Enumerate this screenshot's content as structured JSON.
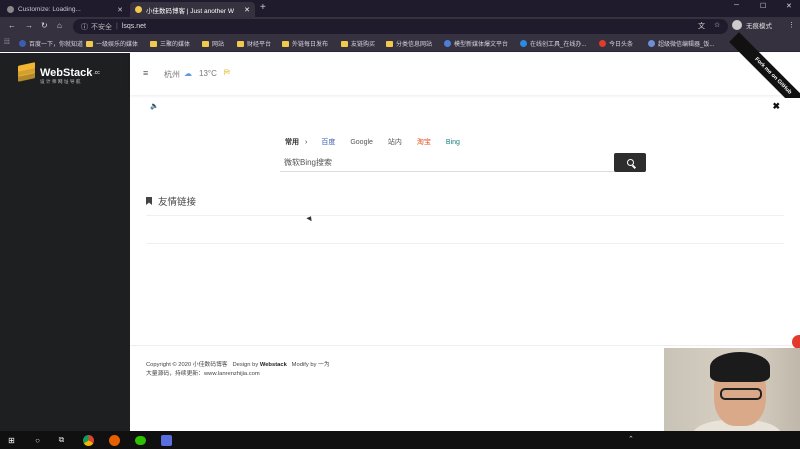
{
  "browser": {
    "tabs": [
      {
        "title": "Customize: Loading...",
        "active": false
      },
      {
        "title": "小佳数码博客 | Just another W",
        "active": true
      }
    ],
    "new_tab": "+",
    "window_controls": [
      "─",
      "☐",
      "✕"
    ],
    "address": {
      "security": "不安全",
      "separator": "|",
      "url": "lsqs.net"
    },
    "profile_label": "无痕模式",
    "bookmarks": [
      "百度一下，你就知道",
      "一级娱乐的媒体",
      "三聚的媒体",
      "网站",
      "财经平台",
      "外链每日发布",
      "友链购买",
      "分类信息网站",
      "模型新媒体爆文平台",
      "在线创工具_在线办...",
      "今日头条",
      "超级微信编辑器_饭..."
    ]
  },
  "sidebar": {
    "logo_name": "WebStack",
    "logo_suffix": ".cc",
    "logo_tagline": "设计师网址导航"
  },
  "header": {
    "city": "杭州",
    "temperature": "13°C",
    "ribbon": "Fork me on GitHub"
  },
  "search": {
    "group_label": "常用",
    "arrow": "›",
    "engines": [
      {
        "label": "百度",
        "color": "#3b5db0"
      },
      {
        "label": "Google",
        "color": "#555555"
      },
      {
        "label": "站内",
        "color": "#555555"
      },
      {
        "label": "淘宝",
        "color": "#e44d1f"
      },
      {
        "label": "Bing",
        "color": "#1a7d7d"
      }
    ],
    "placeholder": "微软Bing搜索"
  },
  "section": {
    "title": "友情链接"
  },
  "footer": {
    "copyright": "Copyright © 2020 小佳数码博客",
    "design_prefix": "Design by",
    "design_by": "Webstack",
    "modify": "Modify by 一为",
    "line2": "大量源码，持续更新：www.lanrenzhijia.com"
  },
  "colors": {
    "accent": "#2d2d2d",
    "sidebar_bg": "#1e1f21",
    "logo_yellow": "#f2b632"
  }
}
